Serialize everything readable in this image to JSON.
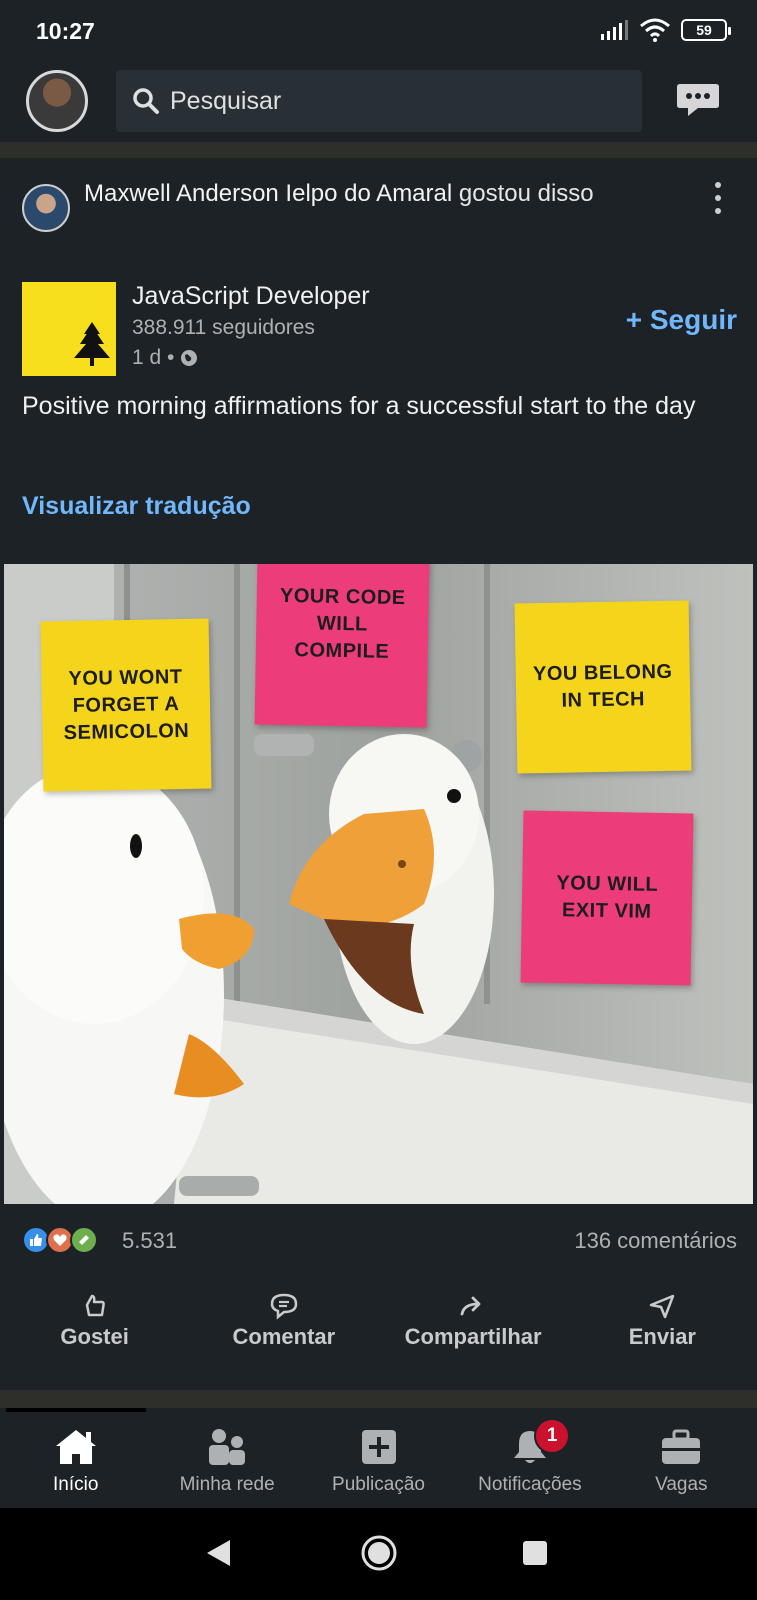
{
  "status_bar": {
    "time": "10:27",
    "battery": "59"
  },
  "top_bar": {
    "search_label": "Pesquisar"
  },
  "post": {
    "liked_by_name": "Maxwell Anderson Ielpo do Amaral",
    "liked_by_suffix": "gostou disso",
    "actor_name": "JavaScript Developer",
    "actor_followers": "388.911 seguidores",
    "actor_time": "1 d •",
    "follow_label": "+ Seguir",
    "text": "Positive morning affirmations for a successful start to the day",
    "translate_label": "Visualizar tradução",
    "image_notes": {
      "note1": "YOU WONT FORGET A SEMICOLON",
      "note2": "YOUR CODE WILL COMPILE",
      "note3": "YOU BELONG IN TECH",
      "note4": "YOU WILL EXIT VIM"
    },
    "reactions_count": "5.531",
    "comments_count": "136 comentários",
    "actions": {
      "like": "Gostei",
      "comment": "Comentar",
      "share": "Compartilhar",
      "send": "Enviar"
    }
  },
  "bottom_nav": {
    "home": "Início",
    "network": "Minha rede",
    "post": "Publicação",
    "notifications": "Notificações",
    "notifications_badge": "1",
    "jobs": "Vagas"
  },
  "colors": {
    "background": "#1d2226",
    "accent_blue": "#71b7fb",
    "js_yellow": "#f7df1e",
    "badge_red": "#cb112d"
  }
}
